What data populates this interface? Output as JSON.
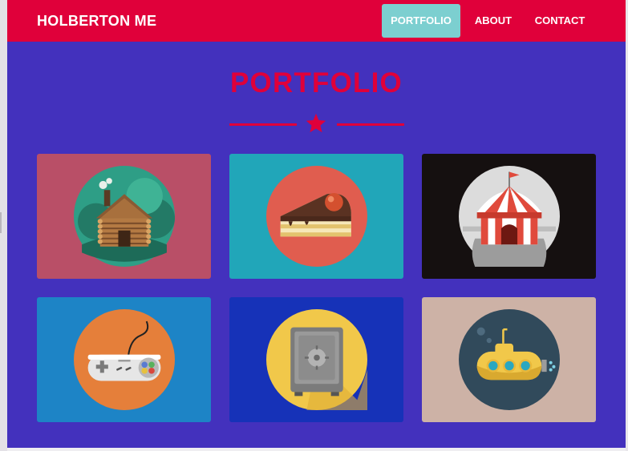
{
  "nav": {
    "brand": "HOLBERTON ME",
    "items": [
      {
        "label": "PORTFOLIO",
        "active": true
      },
      {
        "label": "ABOUT",
        "active": false
      },
      {
        "label": "CONTACT",
        "active": false
      }
    ]
  },
  "main": {
    "title": "PORTFOLIO",
    "portfolio": [
      {
        "icon": "log-cabin-icon",
        "background": "#b94f67",
        "circle": "#2e9e86"
      },
      {
        "icon": "cake-slice-icon",
        "background": "#21a6b9",
        "circle": "#e05d4f"
      },
      {
        "icon": "circus-tent-icon",
        "background": "#151010",
        "circle": "#dcdcdc"
      },
      {
        "icon": "game-controller-icon",
        "background": "#1d84c6",
        "circle": "#e57f3a"
      },
      {
        "icon": "safe-icon",
        "background": "#1632b8",
        "circle": "#f1c84a"
      },
      {
        "icon": "submarine-icon",
        "background": "#cdb2a6",
        "circle": "#314a5b"
      }
    ]
  },
  "colors": {
    "nav_background": "#e0003a",
    "accent": "#e0003a",
    "active_nav": "#7ccfd0",
    "main_background": "#4331bd"
  }
}
